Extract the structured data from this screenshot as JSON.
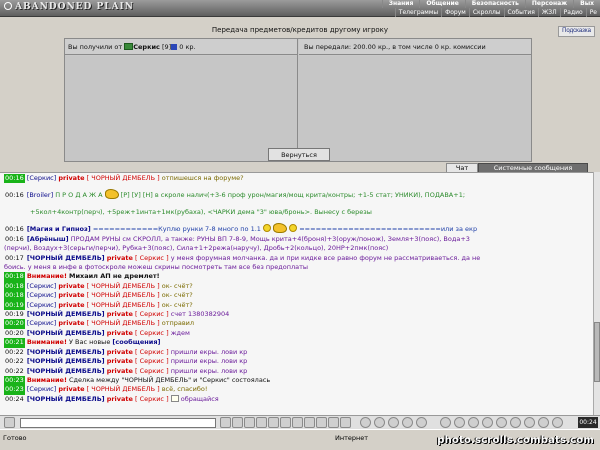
{
  "app": {
    "logo": "ABANDONED PLAIN",
    "menu_top": [
      "Знания",
      "Общение",
      "Безопасность",
      "Персонаж",
      "Вых"
    ],
    "menu_bottom": [
      "Телеграммы",
      "Форум",
      "Скроллы",
      "События",
      "ЖЗЛ",
      "Радио",
      "Ре"
    ]
  },
  "transfer": {
    "title": "Передача предметов/кредитов другому игроку",
    "help_button": "Подсказка",
    "received_prefix": "Вы получили от",
    "received_name": "Серкис",
    "received_level": "[9]",
    "received_amount": "0 кр.",
    "sent_text": "Вы передали: 200.00 кр., в том числе 0 кр. комиссии",
    "return_button": "Вернуться"
  },
  "tabs": {
    "chat": "Чат",
    "system": "Системные сообщения"
  },
  "chat": {
    "l1": {
      "time": "00:16",
      "nick": "[Серкис]",
      "priv": "private",
      "to": "[ ЧОРНЫЙ ДЕМБЕЛЬ ]",
      "text": "отпишешся на форуме?"
    },
    "l2": {
      "time": "00:16",
      "nick": "[Broiler]",
      "text": "П Р О Д А Ж А",
      "text2": "[Р] [У] [Н] в скроле налич(+3-6 проф урон/магия/мощ крита/контры; +1-5 стат; УНИКИ), ПОДАВА+1;"
    },
    "l2b": {
      "text": "+5кол+4контр(перч), +5реж+1инта+1мк(рубаха), <ЧАРКИ дема \"3\" юва/бронь>. Вынесу с березы"
    },
    "l3": {
      "time": "00:16",
      "nick": "[Магия и Гипноз]",
      "text": "============Куплю рунки 7-8 много по 1.1",
      "text2": "==========================или за екр"
    },
    "l4": {
      "time": "00:16",
      "nick": "[Абрёныш]",
      "text": "ПРОДАМ РУНЫ см СКРОЛЛ, а также: РУНЫ ВП 7-8-9, Мощь крита+4(броня)+3(оруж/понож), Земля+3(пояс), Вода+3"
    },
    "l4b": {
      "text": "(перчи), Воздух+3(серьги/перчи), Рубка+3(пояс), Сила+1+2режа(наручу), Дробь+2(кольцо), 20НР+2пмк(пояс)"
    },
    "l5": {
      "time": "00:17",
      "nick": "[ЧОРНЫЙ ДЕМБЕЛЬ]",
      "priv": "private",
      "to": "[ Серкис ]",
      "text": "у меня форумная молчанка. да и при кидке все равно форум не рассматриваеться. да не"
    },
    "l5b": {
      "text": "боись. у меня в инфе в фотоскроле можеш скрины посмотреть там все без предоплаты"
    },
    "l6": {
      "time": "00:18",
      "warn": "Внимание!",
      "text": "Михаил АП не дремлет!"
    },
    "l7": {
      "time": "00:18",
      "nick": "[Серкис]",
      "priv": "private",
      "to": "[ ЧОРНЫЙ ДЕМБЕЛЬ ]",
      "text": "ок- счёт?"
    },
    "l8": {
      "time": "00:18",
      "nick": "[Серкис]",
      "priv": "private",
      "to": "[ ЧОРНЫЙ ДЕМБЕЛЬ ]",
      "text": "ок- счёт?"
    },
    "l9": {
      "time": "00:19",
      "nick": "[Серкис]",
      "priv": "private",
      "to": "[ ЧОРНЫЙ ДЕМБЕЛЬ ]",
      "text": "ок- счёт?"
    },
    "l10": {
      "time": "00:19",
      "nick": "[ЧОРНЫЙ ДЕМБЕЛЬ]",
      "priv": "private",
      "to": "[ Серкис ]",
      "text": "счет 1380382904"
    },
    "l11": {
      "time": "00:20",
      "nick": "[Серкис]",
      "priv": "private",
      "to": "[ ЧОРНЫЙ ДЕМБЕЛЬ ]",
      "text": "отправил"
    },
    "l12": {
      "time": "00:20",
      "nick": "[ЧОРНЫЙ ДЕМБЕЛЬ]",
      "priv": "private",
      "to": "[ Серкис ]",
      "text": "ждем"
    },
    "l13": {
      "time": "00:21",
      "warn": "Внимание!",
      "text": "У Вас новые",
      "link": "[сообщения]"
    },
    "l14": {
      "time": "00:22",
      "nick": "[ЧОРНЫЙ ДЕМБЕЛЬ]",
      "priv": "private",
      "to": "[ Серкис ]",
      "text": "пришли екры. лови кр"
    },
    "l15": {
      "time": "00:22",
      "nick": "[ЧОРНЫЙ ДЕМБЕЛЬ]",
      "priv": "private",
      "to": "[ Серкис ]",
      "text": "пришли екры. лови кр"
    },
    "l16": {
      "time": "00:22",
      "nick": "[ЧОРНЫЙ ДЕМБЕЛЬ]",
      "priv": "private",
      "to": "[ Серкис ]",
      "text": "пришли екры. лови кр"
    },
    "l17": {
      "time": "00:23",
      "warn": "Внимание!",
      "text": "Сделка между \"ЧОРНЫЙ ДЕМБЕЛЬ\" и \"Серкис\" состоялась"
    },
    "l18": {
      "time": "00:23",
      "nick": "[Серкис]",
      "priv": "private",
      "to": "[ ЧОРНЫЙ ДЕМБЕЛЬ ]",
      "text": "всё, спасибо!"
    },
    "l19": {
      "time": "00:24",
      "nick": "[ЧОРНЫЙ ДЕМБЕЛЬ]",
      "priv": "private",
      "to": "[ Серкис ]",
      "text": "обращайся"
    }
  },
  "toolbar": {
    "clock": "00:24"
  },
  "status": {
    "left": "Готово",
    "zone": "Интернет"
  },
  "watermark": "photo.scrolls.combats.com"
}
